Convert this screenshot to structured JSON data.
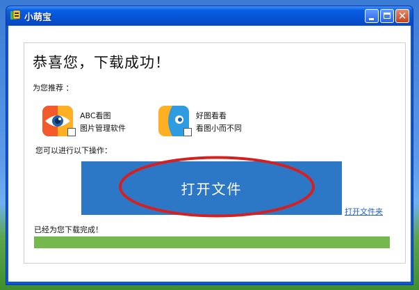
{
  "window": {
    "title": "小萌宝",
    "close_symbol": "✕"
  },
  "content": {
    "headline": "恭喜您，下载成功！",
    "recommend_label": "为您推荐 ：",
    "apps": [
      {
        "name": "ABC看图",
        "desc": "图片管理软件",
        "icon": "eye-icon",
        "checked": false
      },
      {
        "name": "好图看看",
        "desc": "看图小而不同",
        "icon": "image-viewer-icon",
        "checked": false
      }
    ],
    "ops_label": "您可以进行以下操作：",
    "open_file_label": "打开文件",
    "open_folder_label": "打开文件夹",
    "done_label": "已经为您下载完成！",
    "progress": 1.0
  },
  "colors": {
    "titlebar": "#0553d6",
    "primary_button": "#2d78c6",
    "progress_fill": "#75b94e",
    "annotation": "#d42020",
    "link": "#2160c4"
  }
}
